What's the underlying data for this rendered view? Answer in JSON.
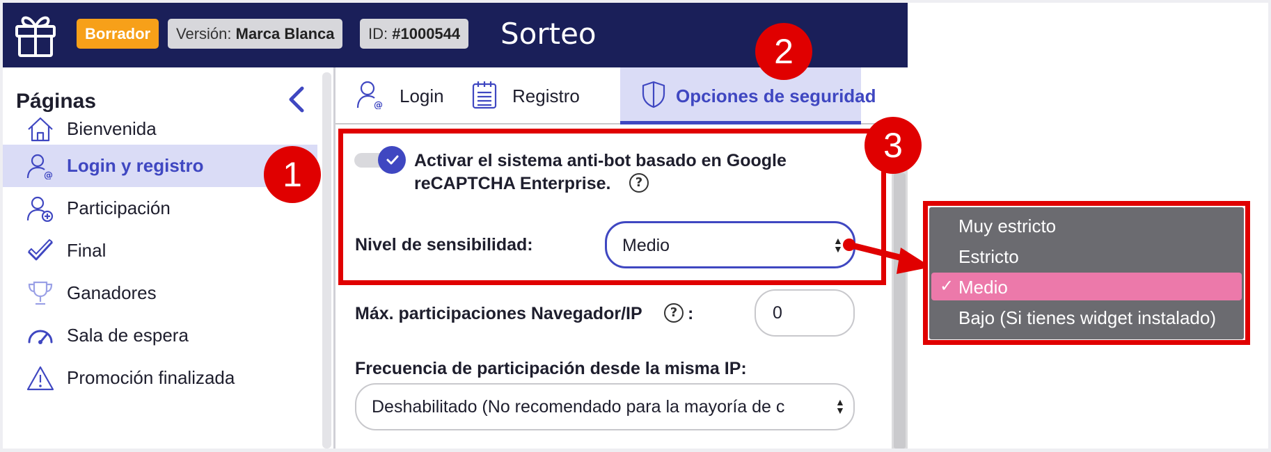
{
  "header": {
    "badge_draft": "Borrador",
    "version_label": "Versión:",
    "version_value": "Marca Blanca",
    "id_label": "ID:",
    "id_value": "#1000544",
    "title": "Sorteo"
  },
  "sidebar": {
    "heading": "Páginas",
    "items": [
      {
        "label": "Bienvenida",
        "icon": "home-icon"
      },
      {
        "label": "Login y registro",
        "icon": "user-at-icon",
        "active": true
      },
      {
        "label": "Participación",
        "icon": "user-plus-icon"
      },
      {
        "label": "Final",
        "icon": "check-icon"
      },
      {
        "label": "Ganadores",
        "icon": "trophy-icon"
      },
      {
        "label": "Sala de espera",
        "icon": "speedometer-icon"
      },
      {
        "label": "Promoción finalizada",
        "icon": "warning-icon"
      }
    ]
  },
  "tabs": [
    {
      "label": "Login",
      "icon": "user-at-icon"
    },
    {
      "label": "Registro",
      "icon": "notepad-icon"
    },
    {
      "label": "Opciones de seguridad",
      "icon": "shield-icon",
      "active": true
    }
  ],
  "security": {
    "recaptcha_enabled": true,
    "recaptcha_line1": "Activar el sistema anti-bot basado en Google",
    "recaptcha_line2": "reCAPTCHA Enterprise.",
    "help_glyph": "?",
    "sensitivity_label": "Nivel de sensibilidad:",
    "sensitivity_value": "Medio",
    "max_participations_label": "Máx. participaciones Navegador/IP",
    "max_participations_colon": ":",
    "max_participations_value": "0",
    "frequency_label": "Frecuencia de participación desde la misma IP:",
    "frequency_value": "Deshabilitado (No recomendado para la mayoría de c"
  },
  "sensitivity_menu": {
    "options": [
      "Muy estricto",
      "Estricto",
      "Medio",
      "Bajo (Si tienes widget instalado)"
    ],
    "selected_index": 2,
    "check_glyph": "✓"
  },
  "markers": [
    "1",
    "2",
    "3"
  ],
  "colors": {
    "header_bg": "#1a1f59",
    "accent": "#3f47c1",
    "active_bg": "#dadcf6",
    "draft_badge": "#f7a019",
    "highlight_red": "#e00000",
    "menu_bg": "#6b6b70",
    "menu_selected": "#ec79aa"
  }
}
